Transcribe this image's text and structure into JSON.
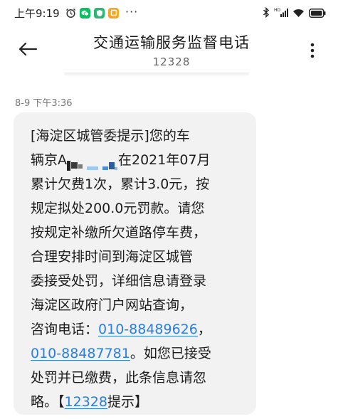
{
  "status_bar": {
    "time": "上午9:19",
    "more": "···"
  },
  "header": {
    "title": "交通运输服务监督电话",
    "subtitle": "12328"
  },
  "message": {
    "timestamp": "8-9 下午3:36",
    "lines": [
      "[海淀区城管委提示]您的车",
      "辆京A",
      "在2021年07月",
      "累计欠费1次，累计3.0元，按",
      "规定拟处200.0元罚款。请您",
      "按规定补缴所欠道路停车费，",
      "合理安排时间到海淀区城管",
      "委接受处罚，详细信息请登录",
      "海淀区政府门户网站查询，",
      "咨询电话：",
      "010-88489626",
      "，",
      "010-88487781",
      "。如您已接受",
      "处罚并已缴费，此条信息请忽",
      "略。【",
      "12328",
      "提示】"
    ]
  },
  "colors": {
    "link": "#2a7de1",
    "bubble": "#f2f2f2",
    "wechat_green": "#07c160",
    "shield_green": "#2bb673",
    "orange": "#f5a623"
  },
  "icons": [
    "alarm-icon",
    "wechat-icon",
    "shield-icon",
    "notes-icon",
    "bluetooth-icon",
    "signal-icon",
    "wifi-icon",
    "battery-icon",
    "back-arrow-icon",
    "more-vertical-icon"
  ]
}
